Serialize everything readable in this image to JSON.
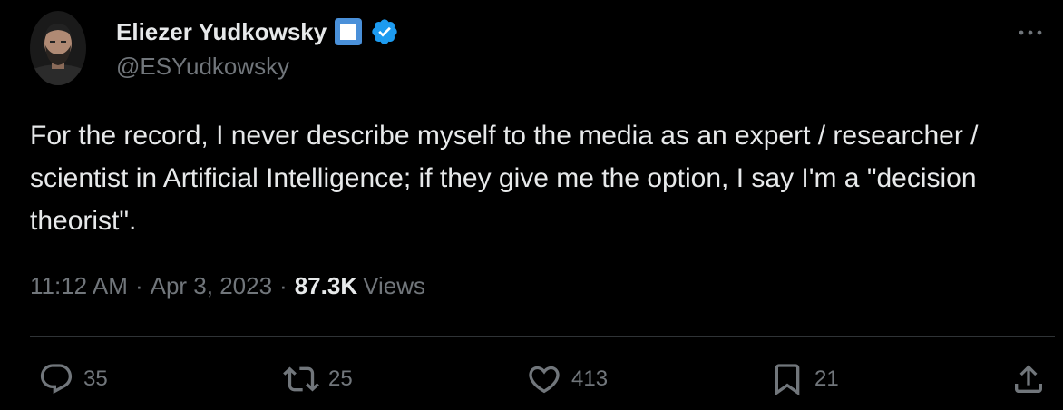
{
  "author": {
    "display_name": "Eliezer Yudkowsky",
    "handle": "@ESYudkowsky"
  },
  "tweet": {
    "text": "For the record, I never describe myself to the media as an expert / researcher / scientist in Artificial Intelligence; if they give me the option, I say I'm a \"decision theorist\".",
    "time": "11:12 AM",
    "separator": "·",
    "date": "Apr 3, 2023",
    "views_count": "87.3K",
    "views_label": "Views"
  },
  "actions": {
    "replies": "35",
    "retweets": "25",
    "likes": "413",
    "bookmarks": "21"
  },
  "icons": {
    "avatar": "avatar-photo",
    "emoji": "white-square-button-emoji",
    "verified": "verified-badge-icon",
    "more": "more-icon",
    "reply": "reply-icon",
    "retweet": "retweet-icon",
    "like": "heart-icon",
    "bookmark": "bookmark-icon",
    "share": "share-icon"
  },
  "colors": {
    "background": "#000000",
    "text_primary": "#e7e9ea",
    "text_secondary": "#71767b",
    "verified_blue": "#1d9bf0",
    "emoji_blue": "#4a90d9",
    "divider": "#2f3336"
  }
}
